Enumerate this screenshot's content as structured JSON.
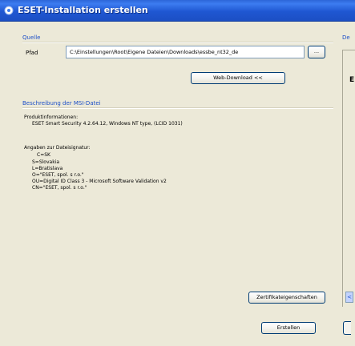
{
  "window": {
    "title": "ESET-Installation erstellen",
    "title_icon": "window-icon"
  },
  "source": {
    "section_title": "Quelle",
    "path_label": "Pfad",
    "path_value": "C:\\Einstellungen\\Root\\Eigene Dateien\\Downloads\\essbe_nt32_de",
    "browse_label": "...",
    "web_download_label": "Web-Download <<"
  },
  "msi": {
    "section_title": "Beschreibung der MSI-Datei",
    "product_info_label": "Produktinformationen:",
    "product_info_value": "ESET Smart Security 4.2.64.12, Windows NT type, (LCID 1031)",
    "signature_label": "Angaben zur Dateisignatur:",
    "signature_lines": [
      "C=SK",
      "S=Slovakia",
      "L=Bratislava",
      "O=\"ESET, spol. s r.o.\"",
      "OU=Digital ID Class 3 - Microsoft Software Validation v2",
      "CN=\"ESET, spol. s r.o.\""
    ],
    "cert_props_label": "Zertifikateigenschaften"
  },
  "footer": {
    "create_label": "Erstellen"
  },
  "right_panel": {
    "header_fragment": "De",
    "letter": "E",
    "scroll_arrow": "<"
  },
  "colors": {
    "titlebar": "#2456d1",
    "section_title": "#1d4fc7",
    "dialog_bg": "#ece9d8",
    "button_border": "#003c74"
  }
}
